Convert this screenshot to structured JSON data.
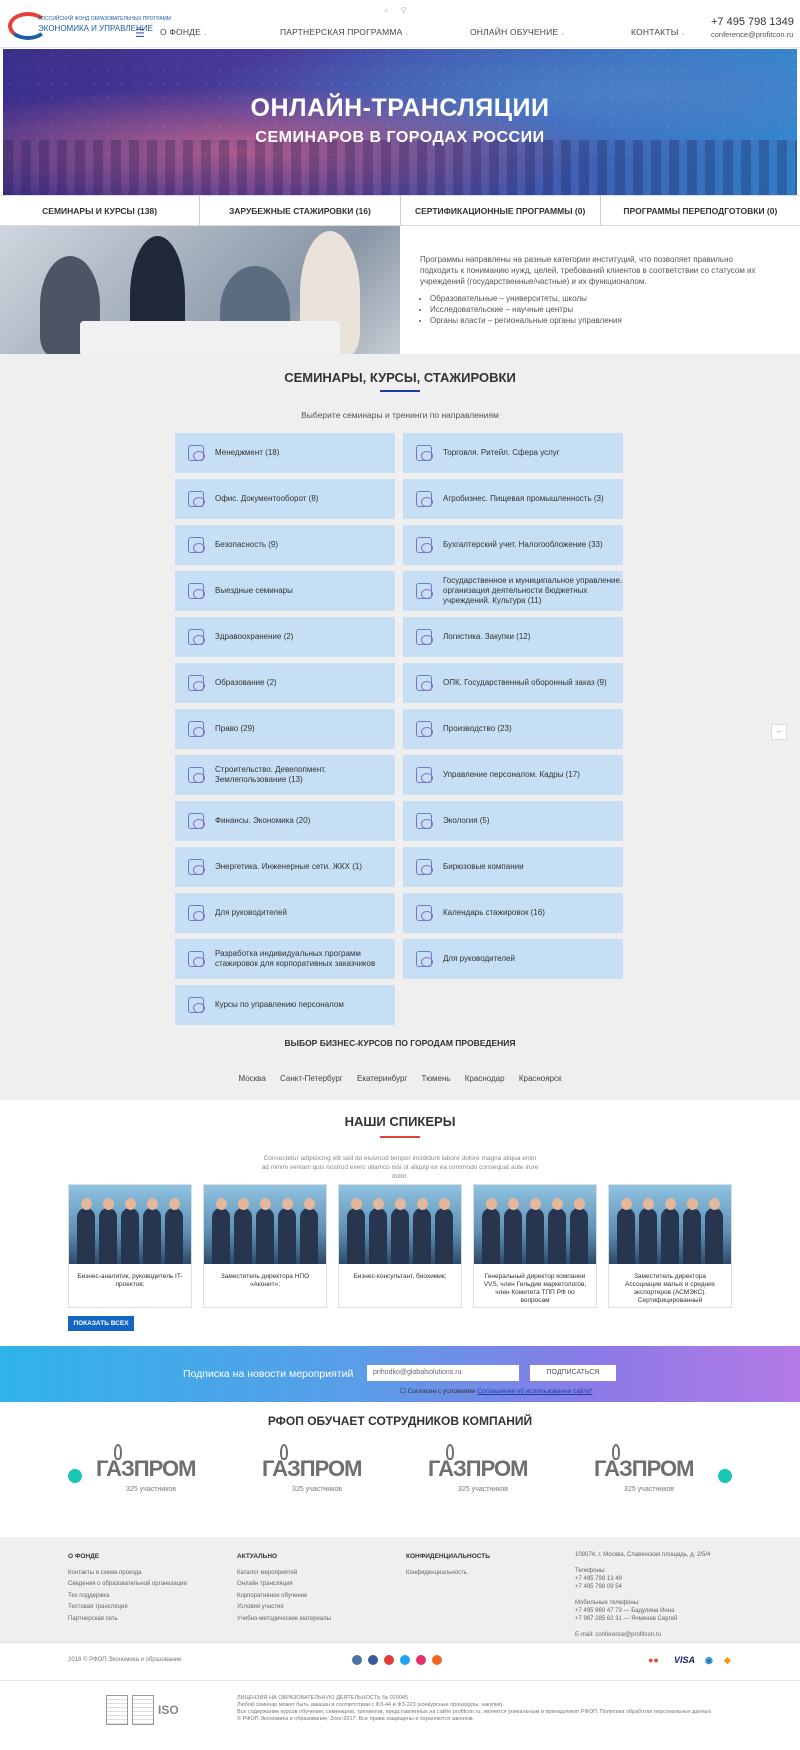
{
  "header": {
    "logo_line1": "РОССИЙСКИЙ ФОНД ОБРАЗОВАТЕЛЬНЫХ ПРОГРАММ",
    "logo_line2": "ЭКОНОМИКА И УПРАВЛЕНИЕ",
    "nav": [
      "О ФОНДЕ",
      "ПАРТНЕРСКАЯ ПРОГРАММА",
      "ОНЛАЙН ОБУЧЕНИЕ",
      "КОНТАКТЫ"
    ],
    "phone": "+7 495 798 1349",
    "email": "conference@profitcon.ru"
  },
  "hero": {
    "title": "ОНЛАЙН-ТРАНСЛЯЦИИ",
    "subtitle": "СЕМИНАРОВ В ГОРОДАХ РОССИИ"
  },
  "tabs": [
    "СЕМИНАРЫ И КУРСЫ (138)",
    "ЗАРУБЕЖНЫЕ СТАЖИРОВКИ (16)",
    "СЕРТИФИКАЦИОННЫЕ ПРОГРАММЫ (0)",
    "ПРОГРАММЫ ПЕРЕПОДГОТОВКИ (0)"
  ],
  "intro": {
    "text": "Программы направлены на разные категории институций, что позволяет правильно подходить к пониманию нужд, целей, требований клиентов в соответствии со статусом их учреждений (государственные/частные) и их функционалом.",
    "bullets": [
      "Образовательные – университеты, школы",
      "Исследовательские – научные центры",
      "Органы власти – региональные органы управления"
    ]
  },
  "seminars": {
    "title": "СЕМИНАРЫ, КУРСЫ, СТАЖИРОВКИ",
    "subtitle": "Выберите семинары и тренинги по направлениям",
    "left": [
      "Менеджмент  (18)",
      "Офис. Документооборот  (8)",
      "Безопасность  (9)",
      "Выездные семинары",
      "Здравоохранение  (2)",
      "Образование  (2)",
      "Право  (29)",
      "Строительство. Девелопмент. Землепользование  (13)",
      "Финансы. Экономика  (20)",
      "Энергетика. Инженерные сети. ЖКХ  (1)",
      "Для руководителей",
      "Разработка индивидуальных программ стажировок для корпоративных заказчиков",
      "Курсы по управлению персоналом"
    ],
    "right": [
      "Торговля. Ритейл. Сфера услуг",
      "Агробизнес. Пищевая промышленность  (3)",
      "Бухгалтерский учет. Налогообложение  (33)",
      "Государственное и муниципальное управление. организация деятельности бюджетных учреждений. Культура  (11)",
      "Логистика. Закупки  (12)",
      "ОПК. Государственный оборонный заказ  (9)",
      "Производство  (23)",
      "Управление персоналом. Кадры  (17)",
      "Экология  (5)",
      "Бирюзовые компании",
      "Календарь стажировок  (16)",
      "Для руководителей"
    ],
    "cities_title": "ВЫБОР БИЗНЕС-КУРСОВ ПО ГОРОДАМ ПРОВЕДЕНИЯ",
    "cities": [
      "Москва",
      "Санкт-Петербург",
      "Екатеринбург",
      "Тюмень",
      "Краснодар",
      "Красноярск"
    ]
  },
  "speakers": {
    "title": "НАШИ СПИКЕРЫ",
    "lorem": "Consectetur adipisicing elit sed do eiusmod tempor incididunt labore dolore magna aliqua enim ad minim veniam quis nostrud exerc ullamco nisi ut aliquip ex ea commodo consequat aute irure dolor.",
    "items": [
      "Бизнес-аналитик, руководитель IT-проектов;",
      "Заместитель директора НПО «Аконит»;",
      "Бизнес-консультант, биохимик;",
      "Генеральный директор компании VVS, член Гильдии маркетологов, член Комитета ТПП РФ по вопросам",
      "Заместитель директора Ассоциации малых и средних экспортеров (АСМЭКС). Сертифицированный"
    ],
    "show_all": "ПОКАЗАТЬ ВСЕХ"
  },
  "subscribe": {
    "label": "Подписка на новости мероприятий",
    "email_value": "prihodko@globalsolutions.ru",
    "button": "ПОДПИСАТЬСЯ",
    "agree_prefix": "Согласен с условиями ",
    "agree_link": "Соглашения об использовании сайта*"
  },
  "clients": {
    "title": "РФОП ОБУЧАЕТ СОТРУДНИКОВ КОМПАНИЙ",
    "logos": [
      {
        "name": "ГАЗПРОМ",
        "count": "325 участников"
      },
      {
        "name": "ГАЗПРОМ",
        "count": "325 участников"
      },
      {
        "name": "ГАЗПРОМ",
        "count": "325 участников"
      },
      {
        "name": "ГАЗПРОМ",
        "count": "325 участников"
      }
    ]
  },
  "footer": {
    "col1_title": "О ФОНДЕ",
    "col1": [
      "Контакты и схема проезда",
      "Сведения о образовательной организации",
      "Тех поддержка",
      "Тестовая трансляция",
      "Партнерская сеть"
    ],
    "col2_title": "АКТУАЛЬНО",
    "col2": [
      "Каталог мероприятий",
      "Онлайн трансляция",
      "Корпоративное обучение",
      "Условия участия",
      "Учебно-методические материалы"
    ],
    "col3_title": "КОНФИДЕНЦИАЛЬНОСТЬ",
    "col3": [
      "Конфиденциальность"
    ],
    "address": "109074, г. Москва, Славянская площадь, д. 2/5/4",
    "phones_label": "Телефоны:",
    "phones": [
      "+7 495 798 13 49",
      "+7 495 798 09 54"
    ],
    "mobile_label": "Мобильные телефоны:",
    "mobiles": [
      "+7 495 960 47 73 — Бадулина Инна",
      "+7 967 285 62 31 — Ячменев Сергей"
    ],
    "email": "E-mail: conference@profitcon.ru",
    "copyright": "2018 © РФОП Экономика и образование",
    "pay": [
      "VISA"
    ],
    "license": [
      "ЛИЦЕНЗИЯ НА ОБРАЗОВАТЕЛЬНУЮ ДЕЯТЕЛЬНОСТЬ № 029045",
      "Любой семинар может быть заказан в соответствии с ФЗ-44 и ФЗ-223 (конкурсные процедуры, закупки).",
      "Все содержание курсов обучения, семинаров, тренингов, представленных на сайте profitcon.ru, является уникальным и принадлежит РФОП. Политика обработки персональных данных",
      "© РФОП Экономика и образование, 2ххх-2017. Все права защищены и охраняются законом."
    ],
    "iso": "ISO"
  },
  "colors": {
    "accent": "#1366c2",
    "card": "#c6dff4",
    "teal": "#1ac6b4",
    "red": "#e5413a"
  }
}
